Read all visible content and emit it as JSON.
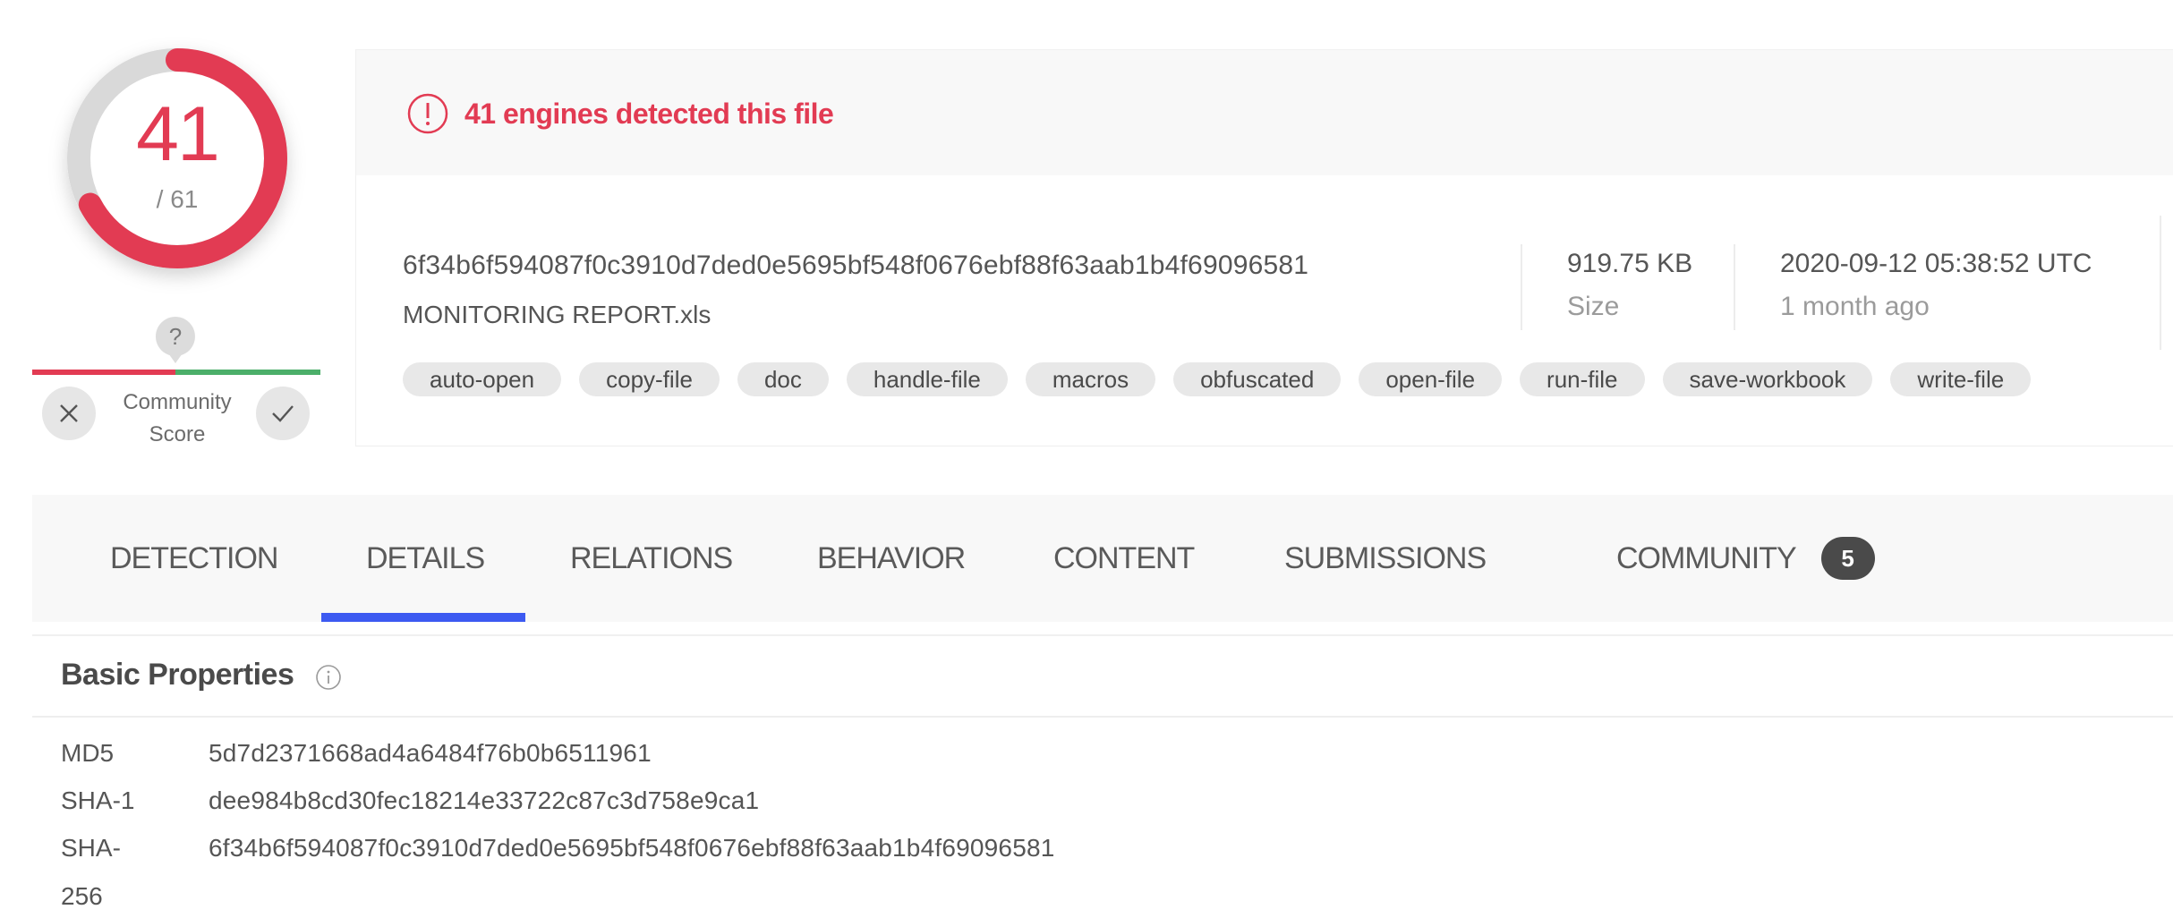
{
  "gauge": {
    "detections": "41",
    "total_label": "/ 61",
    "detected_count": 41,
    "total_engines": 61,
    "colors": {
      "detected": "#e23b53",
      "remaining": "#d9d9d9"
    }
  },
  "community_score": {
    "pin_icon": "question-mark-icon",
    "label_line1": "Community",
    "label_line2": "Score",
    "vote_down_icon": "x-icon",
    "vote_up_icon": "checkmark-icon",
    "score_position": 0.5,
    "colors": {
      "negative": "#e23b53",
      "positive": "#4caf6a"
    }
  },
  "summary": {
    "alert_icon": "exclamation-circle-icon",
    "alert_text": "41 engines detected this file",
    "file_hash": "6f34b6f594087f0c3910d7ded0e5695bf548f0676ebf88f63aab1b4f69096581",
    "file_name": "MONITORING REPORT.xls",
    "size_value": "919.75 KB",
    "size_label": "Size",
    "date_value": "2020-09-12 05:38:52 UTC",
    "date_relative": "1 month ago",
    "tags": [
      "auto-open",
      "copy-file",
      "doc",
      "handle-file",
      "macros",
      "obfuscated",
      "open-file",
      "run-file",
      "save-workbook",
      "write-file"
    ]
  },
  "tabs": {
    "items": [
      {
        "label": "DETECTION"
      },
      {
        "label": "DETAILS",
        "active": true
      },
      {
        "label": "RELATIONS"
      },
      {
        "label": "BEHAVIOR"
      },
      {
        "label": "CONTENT"
      },
      {
        "label": "SUBMISSIONS"
      },
      {
        "label": "COMMUNITY",
        "badge": "5"
      }
    ],
    "active_color": "#3d5af1"
  },
  "basic_properties": {
    "title": "Basic Properties",
    "info_icon": "info-icon",
    "rows": [
      {
        "key": "MD5",
        "value": "5d7d2371668ad4a6484f76b0b6511961"
      },
      {
        "key": "SHA-1",
        "value": "dee984b8cd30fec18214e33722c87c3d758e9ca1"
      },
      {
        "key": "SHA-256",
        "key_line1": "SHA-",
        "key_line2": "256",
        "value": "6f34b6f594087f0c3910d7ded0e5695bf548f0676ebf88f63aab1b4f69096581"
      }
    ]
  }
}
